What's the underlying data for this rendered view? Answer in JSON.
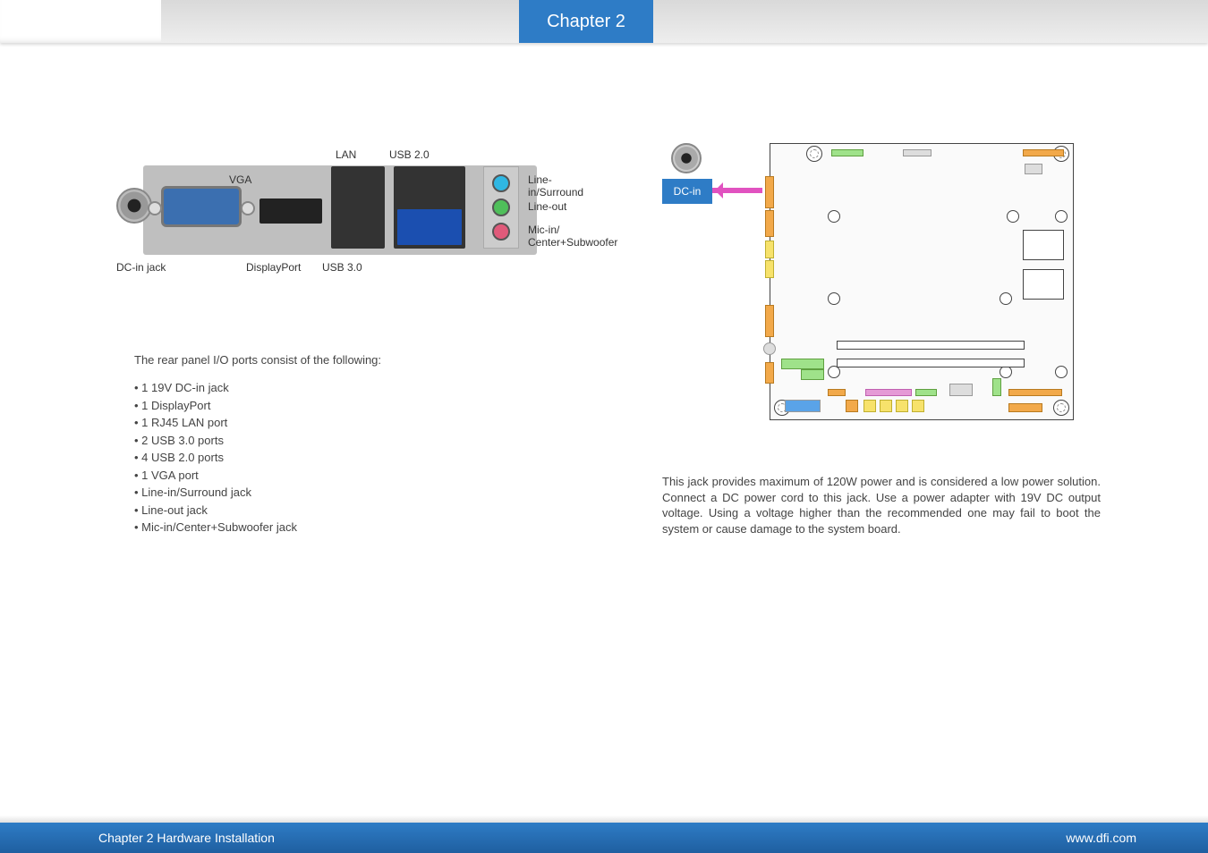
{
  "header": {
    "chapter": "Chapter 2"
  },
  "io_labels": {
    "lan": "LAN",
    "usb20": "USB 2.0",
    "vga": "VGA",
    "dcin_jack": "DC-in jack",
    "displayport": "DisplayPort",
    "usb30": "USB 3.0",
    "line_in": "Line-in/Surround",
    "line_out": "Line-out",
    "mic_in": "Mic-in/\nCenter+Subwoofer"
  },
  "intro": "The rear panel I/O ports consist of the following:",
  "ports": [
    "1 19V DC-in jack",
    "1 DisplayPort",
    "1 RJ45 LAN port",
    "2 USB 3.0 ports",
    "4 USB 2.0 ports",
    "1 VGA port",
    "Line-in/Surround jack",
    "Line-out jack",
    "Mic-in/Center+Subwoofer jack"
  ],
  "mobo": {
    "dc_label": "DC-in"
  },
  "body_text": "This jack provides maximum of 120W power and is considered a low power solution. Connect a DC power cord to this jack. Use a power adapter with 19V DC output voltage. Using a voltage higher than the recommended one may fail to boot the system or cause damage to the system board.",
  "footer": {
    "left": "Chapter 2 Hardware Installation",
    "right": "www.dfi.com"
  }
}
